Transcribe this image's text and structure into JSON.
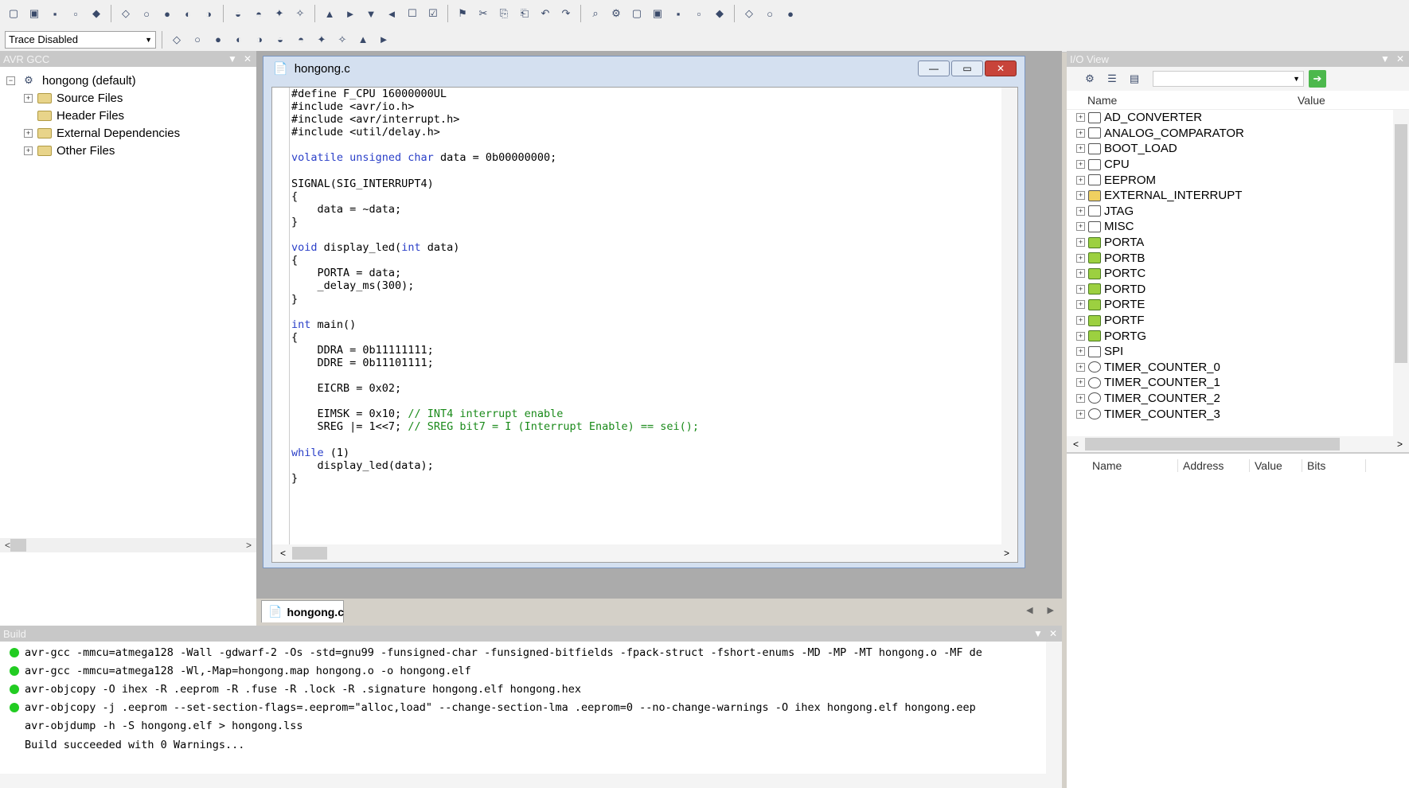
{
  "toolbar": {
    "trace_select": "Trace Disabled",
    "icons_row1": [
      "new-file-icon",
      "open-folder-icon",
      "save-icon",
      "save-all-icon",
      "close-icon",
      "cut-icon",
      "copy-icon",
      "paste-icon",
      "print-icon",
      "undo-icon",
      "redo-icon",
      "find-icon",
      "find-in-files-icon",
      "binoculars-icon",
      "bookmark-icon",
      "bookmark-next-icon",
      "bookmark-prev-icon",
      "bookmark-clear-icon",
      "indent-icon",
      "outdent-icon",
      "build-icon",
      "compile-icon",
      "rebuild-icon",
      "clean-icon",
      "export-icon",
      "debug-icon",
      "run-icon",
      "stop-icon",
      "step-into-icon",
      "step-over-icon",
      "step-out-icon",
      "run-to-cursor-icon",
      "reset-icon",
      "breakpoint-icon",
      "breakpoints-icon",
      "watch-icon"
    ],
    "icons_row2": [
      "debug-step-icon",
      "disassembler-icon",
      "memory-icon",
      "register-icon",
      "io-view-icon",
      "trace-icon",
      "auto-icon",
      "cpu-icon",
      "toggle-icon",
      "stop-debug-icon",
      "options-icon"
    ]
  },
  "left_panel": {
    "title": "AVR GCC",
    "tree": [
      {
        "label": "hongong (default)",
        "level": 0,
        "expander": "−",
        "icon": "project-icon"
      },
      {
        "label": "Source Files",
        "level": 1,
        "expander": "+",
        "icon": "folder-icon"
      },
      {
        "label": "Header Files",
        "level": 1,
        "expander": "",
        "icon": "folder-icon"
      },
      {
        "label": "External Dependencies",
        "level": 1,
        "expander": "+",
        "icon": "folder-icon"
      },
      {
        "label": "Other Files",
        "level": 1,
        "expander": "+",
        "icon": "folder-icon"
      }
    ]
  },
  "editor": {
    "title": "hongong.c",
    "tab_label": "hongong.c",
    "code_lines": [
      [
        [
          "#define F_CPU 16000000UL",
          ""
        ]
      ],
      [
        [
          "#include <avr/io.h>",
          ""
        ]
      ],
      [
        [
          "#include <avr/interrupt.h>",
          ""
        ]
      ],
      [
        [
          "#include <util/delay.h>",
          ""
        ]
      ],
      [
        [
          "",
          ""
        ]
      ],
      [
        [
          "volatile unsigned char",
          "kw"
        ],
        [
          " data = 0b00000000;",
          ""
        ]
      ],
      [
        [
          "",
          ""
        ]
      ],
      [
        [
          "SIGNAL(SIG_INTERRUPT4)",
          ""
        ]
      ],
      [
        [
          "{",
          ""
        ]
      ],
      [
        [
          "    data = ~data;",
          ""
        ]
      ],
      [
        [
          "}",
          ""
        ]
      ],
      [
        [
          "",
          ""
        ]
      ],
      [
        [
          "void",
          "kw"
        ],
        [
          " display_led(",
          ""
        ],
        [
          "int",
          "kw"
        ],
        [
          " data)",
          ""
        ]
      ],
      [
        [
          "{",
          ""
        ]
      ],
      [
        [
          "    PORTA = data;",
          ""
        ]
      ],
      [
        [
          "    _delay_ms(300);",
          ""
        ]
      ],
      [
        [
          "}",
          ""
        ]
      ],
      [
        [
          "",
          ""
        ]
      ],
      [
        [
          "int",
          "kw"
        ],
        [
          " main()",
          ""
        ]
      ],
      [
        [
          "{",
          ""
        ]
      ],
      [
        [
          "    DDRA = 0b11111111;",
          ""
        ]
      ],
      [
        [
          "    DDRE = 0b11101111;",
          ""
        ]
      ],
      [
        [
          "",
          ""
        ]
      ],
      [
        [
          "    EICRB = 0x02;",
          ""
        ]
      ],
      [
        [
          "",
          ""
        ]
      ],
      [
        [
          "    EIMSK = 0x10; ",
          ""
        ],
        [
          "// INT4 interrupt enable",
          "cm"
        ]
      ],
      [
        [
          "    SREG |= 1<<7; ",
          ""
        ],
        [
          "// SREG bit7 = I (Interrupt Enable) == sei();",
          "cm"
        ]
      ],
      [
        [
          "",
          ""
        ]
      ],
      [
        [
          "while",
          "kw"
        ],
        [
          " (1)",
          ""
        ]
      ],
      [
        [
          "    display_led(data);",
          ""
        ]
      ],
      [
        [
          "}",
          ""
        ]
      ]
    ]
  },
  "io_view": {
    "title": "I/O View",
    "col_name": "Name",
    "col_value": "Value",
    "items": [
      {
        "label": "AD_CONVERTER",
        "icon": "module-icon"
      },
      {
        "label": "ANALOG_COMPARATOR",
        "icon": "module-icon"
      },
      {
        "label": "BOOT_LOAD",
        "icon": "register-icon"
      },
      {
        "label": "CPU",
        "icon": "register-icon"
      },
      {
        "label": "EEPROM",
        "icon": "register-icon"
      },
      {
        "label": "EXTERNAL_INTERRUPT",
        "icon": "interrupt-icon"
      },
      {
        "label": "JTAG",
        "icon": "jtag-icon"
      },
      {
        "label": "MISC",
        "icon": "register-icon"
      },
      {
        "label": "PORTA",
        "icon": "port-icon"
      },
      {
        "label": "PORTB",
        "icon": "port-icon"
      },
      {
        "label": "PORTC",
        "icon": "port-icon"
      },
      {
        "label": "PORTD",
        "icon": "port-icon"
      },
      {
        "label": "PORTE",
        "icon": "port-icon"
      },
      {
        "label": "PORTF",
        "icon": "port-icon"
      },
      {
        "label": "PORTG",
        "icon": "port-icon"
      },
      {
        "label": "SPI",
        "icon": "jtag-icon"
      },
      {
        "label": "TIMER_COUNTER_0",
        "icon": "timer-icon"
      },
      {
        "label": "TIMER_COUNTER_1",
        "icon": "timer-icon"
      },
      {
        "label": "TIMER_COUNTER_2",
        "icon": "timer-icon"
      },
      {
        "label": "TIMER_COUNTER_3",
        "icon": "timer-icon"
      }
    ],
    "detail_cols": [
      "Name",
      "Address",
      "Value",
      "Bits"
    ]
  },
  "build": {
    "title": "Build",
    "lines": [
      {
        "text": "avr-gcc  -mmcu=atmega128 -Wall -gdwarf-2 -Os -std=gnu99 -funsigned-char -funsigned-bitfields -fpack-struct -fshort-enums -MD -MP -MT hongong.o -MF de",
        "dot": true
      },
      {
        "text": "avr-gcc -mmcu=atmega128 -Wl,-Map=hongong.map hongong.o     -o hongong.elf",
        "dot": true
      },
      {
        "text": "avr-objcopy -O ihex -R .eeprom -R .fuse -R .lock -R .signature  hongong.elf hongong.hex",
        "dot": true
      },
      {
        "text": "avr-objcopy -j .eeprom --set-section-flags=.eeprom=\"alloc,load\" --change-section-lma .eeprom=0 --no-change-warnings -O ihex hongong.elf hongong.eep",
        "dot": true
      },
      {
        "text": "avr-objdump -h -S hongong.elf > hongong.lss",
        "dot": false
      },
      {
        "text": "Build succeeded with 0 Warnings...",
        "dot": false
      }
    ]
  },
  "colors": {
    "keyword": "#2a3fc8",
    "comment": "#1a8a1a",
    "status_ok": "#22cc22"
  }
}
